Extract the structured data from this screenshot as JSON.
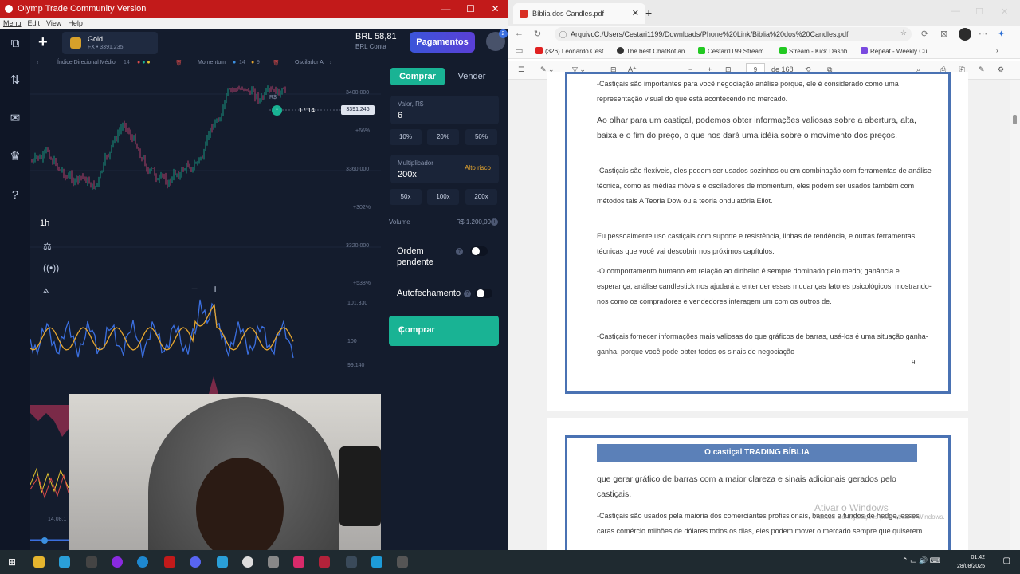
{
  "olymp": {
    "window_title": "Olymp Trade Community Version",
    "menu": [
      "Menu",
      "Edit",
      "View",
      "Help"
    ],
    "asset": {
      "name": "Gold",
      "price_line": "FX • 3391.235"
    },
    "balance": {
      "amount": "BRL 58,81",
      "account": "BRL Conta"
    },
    "payments_button": "Pagamentos",
    "notification_count": "2",
    "indicators": [
      "Índice Direcional Médio",
      "14",
      "Momentum",
      "14",
      "9",
      "Oscilador A"
    ],
    "chart": {
      "currency_label": "R$",
      "timer": "17:14",
      "current_price": "3391.246",
      "axis_labels": [
        "3400.000",
        "+66%",
        "3360.000",
        "+302%",
        "3320.000",
        "+538%",
        "101.330",
        "100",
        "99.140"
      ],
      "timeframe": "1h",
      "date_label": "14.08.1"
    },
    "trade_panel": {
      "buy_tab": "Comprar",
      "sell_tab": "Vender",
      "amount_label": "Valor, R$",
      "amount_value": "6",
      "amount_chips": [
        "10%",
        "20%",
        "50%"
      ],
      "multiplier_label": "Multiplicador",
      "multiplier_value": "200x",
      "risk_label": "Alto risco",
      "multiplier_chips": [
        "50x",
        "100x",
        "200x"
      ],
      "volume_label": "Volume",
      "volume_value": "R$ 1.200,00",
      "pending_order_label": "Ordem pendente",
      "autoclose_label": "Autofechamento",
      "buy_button": "Comprar"
    }
  },
  "browser": {
    "tab_title": "Bíblia dos Candles.pdf",
    "address_label": "Arquivo",
    "url": "C:/Users/Cestari1199/Downloads/Phone%20Link/Biblia%20dos%20Candles.pdf",
    "bookmarks": [
      "(326) Leonardo Cest...",
      "The best ChatBot an...",
      "Cestari1199 Stream...",
      "Stream - Kick Dashb...",
      "Repeat - Weekly Cu..."
    ],
    "pdf": {
      "page_input": "9",
      "page_total": "de 168",
      "page9": {
        "p1": "-Castiçais são importantes para você negociação análise porque, ele é considerado como uma representação visual do que está acontecendo no mercado.",
        "p2": "Ao olhar para um castiçal, podemos obter informações valiosas sobre a abertura, alta, baixa e o fim do preço, o que nos dará uma idéia sobre o movimento dos preços.",
        "p3": "-Castiçais são flexíveis, eles podem ser usados sozinhos ou em combinação com ferramentas de análise técnica, como as médias móveis e osciladores de momentum, eles podem ser usados também com métodos tais A Teoria Dow ou a teoria ondulatória Eliot.",
        "p4": "Eu pessoalmente uso castiçais com suporte e resistência, linhas de tendência, e outras ferramentas técnicas que você vai descobrir nos próximos capítulos.",
        "p5": "-O comportamento humano em relação ao dinheiro é sempre dominado pelo medo; ganância e esperança, análise candlestick nos ajudará a entender essas mudanças fatores psicológicos, mostrando-nos como os compradores e vendedores interagem um com os outros de.",
        "p6": "-Castiçais fornecer informações mais valiosas do que gráficos de barras, usá-los é uma situação ganha-ganha, porque você pode obter todos os sinais de negociação",
        "page_number": "9"
      },
      "page10": {
        "banner": "O castiçal TRADING BÍBLIA",
        "p1": "que gerar gráfico de barras com a maior clareza e sinais adicionais gerados pelo castiçais.",
        "p2": "-Castiçais são usados pela maioria dos comerciantes profissionais, bancos e fundos de hedge, esses caras comércio milhões de dólares todos os dias, eles podem mover o mercado sempre que quiserem."
      }
    },
    "watermark": {
      "title": "Ativar o Windows",
      "subtitle": "Acesse Configurações para ativar o Windows."
    }
  },
  "taskbar": {
    "time": "01:42",
    "date": "28/08/2025"
  }
}
